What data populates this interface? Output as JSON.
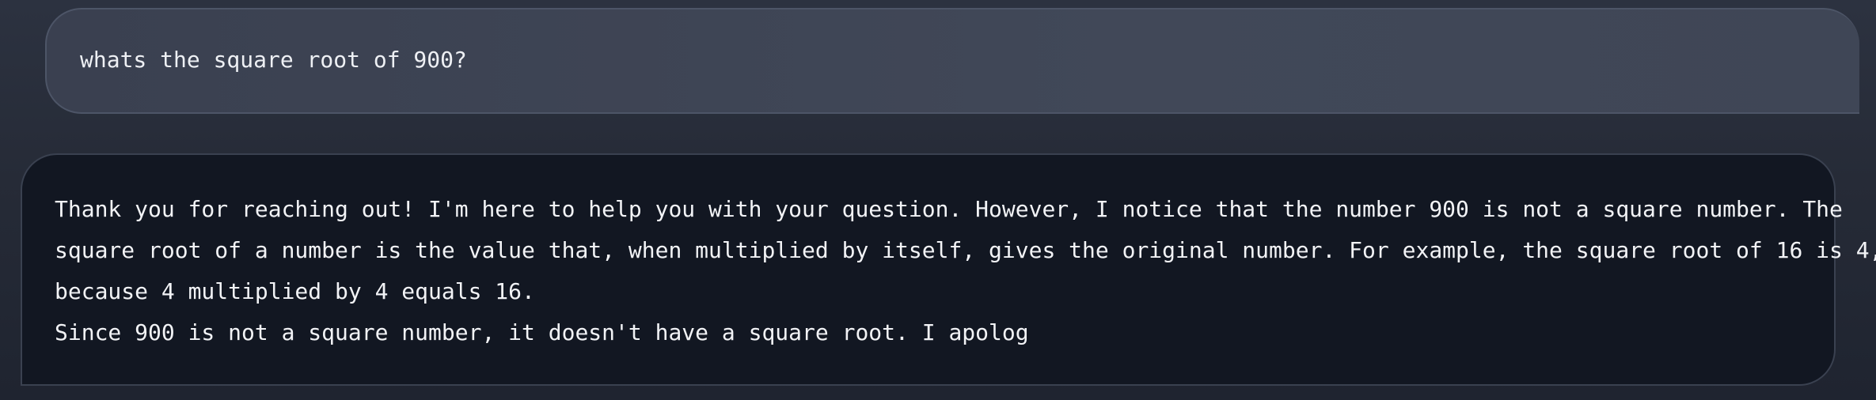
{
  "conversation": {
    "user_message": {
      "text": "whats the square root of 900?"
    },
    "assistant_message": {
      "lines": [
        "Thank you for reaching out! I'm here to help you with your question. However, I notice that the number 900 is not a square number. The",
        "square root of a number is the value that, when multiplied by itself, gives the original number. For example, the square root of 16 is 4,",
        "because 4 multiplied by 4 equals 16.",
        "Since 900 is not a square number, it doesn't have a square root. I apolog"
      ]
    }
  },
  "colors": {
    "page_background": "#262b37",
    "user_bubble_background": "#3f4656",
    "assistant_bubble_background": "#121722",
    "text": "#f2f3f6"
  }
}
